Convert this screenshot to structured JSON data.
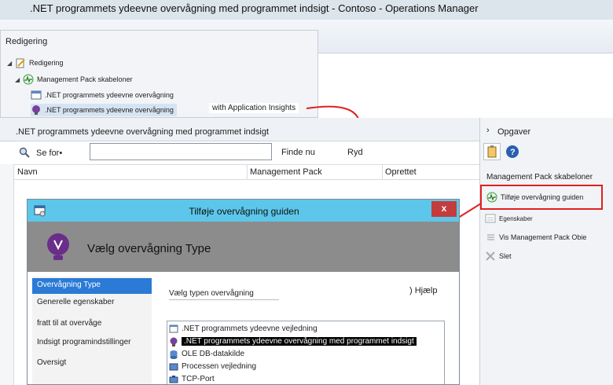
{
  "window": {
    "title": ".NET programmets ydeevne overvågning med programmet indsigt - Contoso - Operations Manager"
  },
  "nav": {
    "header": "Redigering",
    "items": [
      {
        "label": "Redigering"
      },
      {
        "label": "Management Pack skabeloner"
      },
      {
        "label": ".NET programmets ydeevne overvågning"
      },
      {
        "label": ".NET programmets ydeevne overvågning"
      }
    ],
    "callout": "with Application Insights"
  },
  "main": {
    "title": ".NET programmets ydeevne overvågning med programmet indsigt",
    "search_label": "Se for•",
    "search_value": "",
    "find_now": "Finde nu",
    "clear": "Ryd",
    "columns": [
      "Navn",
      "Management Pack",
      "Oprettet"
    ]
  },
  "tasks": {
    "header": "Opgaver",
    "section": "Management Pack skabeloner",
    "items": [
      {
        "label": "Tilføje overvågning guiden"
      },
      {
        "label": "Egenskaber"
      },
      {
        "label": "Vis Management Pack Obie"
      },
      {
        "label": "Slet"
      }
    ]
  },
  "wizard": {
    "title": "Tilføje overvågning guiden",
    "close": "x",
    "banner_title": "Vælg overvågning Type",
    "steps": [
      {
        "label": "Overvågning Type"
      },
      {
        "label": "Generelle egenskaber"
      },
      {
        "label": "fratt til at overvåge"
      },
      {
        "label": "Indsigt programindstillinger"
      },
      {
        "label": "Oversigt"
      }
    ],
    "select_label": "Vælg typen overvågning",
    "help": ") Hjælp",
    "types": [
      {
        "label": ".NET programmets ydeevne vejledning"
      },
      {
        "label": ".NET programmets ydeevne overvågning med programmet indsigt"
      },
      {
        "label": "OLE DB-datakilde"
      },
      {
        "label": "Processen vejledning"
      },
      {
        "label": "TCP-Port"
      }
    ]
  },
  "colors": {
    "accent_red": "#e02020",
    "wizard_title": "#5cc7ea",
    "banner": "#8c8c8c",
    "selection": "#000000"
  }
}
